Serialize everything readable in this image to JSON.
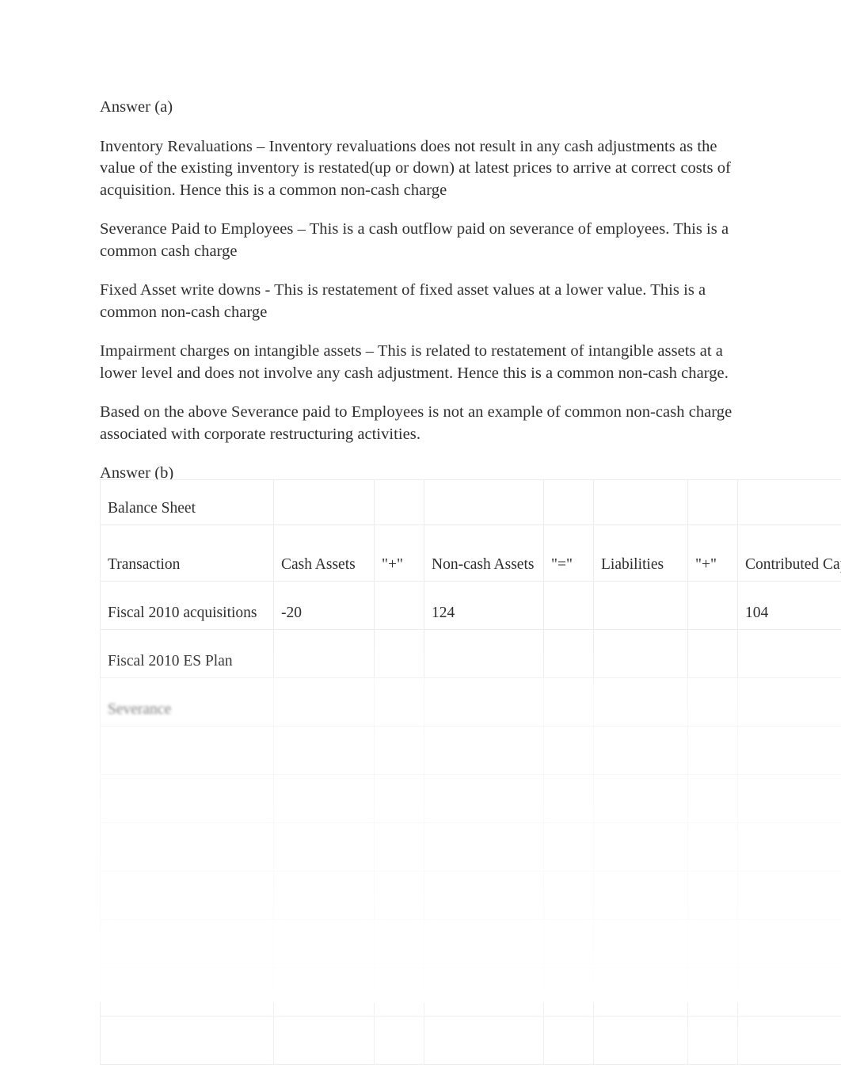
{
  "document": {
    "answer_a_heading": "Answer (a)",
    "answer_b_heading": "Answer (b)",
    "paragraphs": [
      "Inventory Revaluations – Inventory revaluations does not result in any cash adjustments as the value of the existing inventory is restated(up or down) at latest prices to arrive at correct costs of acquisition. Hence this is a common non-cash charge",
      "Severance Paid to Employees – This is a cash outflow paid on severance of employees. This is a common cash charge",
      "Fixed Asset write downs - This is restatement of fixed asset values at a lower value. This is a common non-cash charge",
      "Impairment charges on intangible assets – This is related to restatement of intangible assets at a lower level and does not involve any cash adjustment. Hence this is a common non-cash charge.",
      "Based on the above Severance paid to Employees is not an example of common non-cash charge associated with corporate restructuring activities."
    ]
  },
  "table": {
    "title": "Balance Sheet",
    "headers": {
      "transaction": "Transaction",
      "cash_assets": "Cash Assets",
      "op_plus_1": "\"+\"",
      "noncash_assets": "Non-cash Assets",
      "op_equals": "\"=\"",
      "liabilities": "Liabilities",
      "op_plus_2": "\"+\"",
      "contributed_capital": "Contributed Capital",
      "op_plus_3": "\"+\""
    },
    "rows": [
      {
        "transaction": "Fiscal 2010 acquisitions",
        "cash_assets": "-20",
        "op_plus_1": "",
        "noncash_assets": "124",
        "op_equals": "",
        "liabilities": "",
        "op_plus_2": "",
        "contributed_capital": "104",
        "op_plus_3": "",
        "blur": "none"
      },
      {
        "transaction": "Fiscal 2010 ES Plan",
        "cash_assets": "",
        "op_plus_1": "",
        "noncash_assets": "",
        "op_equals": "",
        "liabilities": "",
        "op_plus_2": "",
        "contributed_capital": "",
        "op_plus_3": "",
        "blur": "none"
      },
      {
        "transaction": "Severance",
        "cash_assets": "",
        "op_plus_1": "",
        "noncash_assets": "",
        "op_equals": "",
        "liabilities": "",
        "op_plus_2": "",
        "contributed_capital": "",
        "op_plus_3": "",
        "blur": "1"
      },
      {
        "transaction": "",
        "cash_assets": "",
        "op_plus_1": "",
        "noncash_assets": "",
        "op_equals": "",
        "liabilities": "",
        "op_plus_2": "",
        "contributed_capital": "",
        "op_plus_3": "",
        "blur": "2"
      },
      {
        "transaction": "",
        "cash_assets": "",
        "op_plus_1": "",
        "noncash_assets": "",
        "op_equals": "",
        "liabilities": "",
        "op_plus_2": "",
        "contributed_capital": "",
        "op_plus_3": "",
        "blur": "3"
      },
      {
        "transaction": "",
        "cash_assets": "",
        "op_plus_1": "",
        "noncash_assets": "",
        "op_equals": "",
        "liabilities": "",
        "op_plus_2": "",
        "contributed_capital": "",
        "op_plus_3": "",
        "blur": "3"
      },
      {
        "transaction": "",
        "cash_assets": "",
        "op_plus_1": "",
        "noncash_assets": "",
        "op_equals": "",
        "liabilities": "",
        "op_plus_2": "",
        "contributed_capital": "",
        "op_plus_3": "",
        "blur": "4"
      },
      {
        "transaction": "",
        "cash_assets": "",
        "op_plus_1": "",
        "noncash_assets": "",
        "op_equals": "",
        "liabilities": "",
        "op_plus_2": "",
        "contributed_capital": "",
        "op_plus_3": "",
        "blur": "4"
      },
      {
        "transaction": "",
        "cash_assets": "",
        "op_plus_1": "",
        "noncash_assets": "",
        "op_equals": "",
        "liabilities": "",
        "op_plus_2": "",
        "contributed_capital": "",
        "op_plus_3": "",
        "blur": "5"
      },
      {
        "transaction": "",
        "cash_assets": "",
        "op_plus_1": "",
        "noncash_assets": "",
        "op_equals": "",
        "liabilities": "",
        "op_plus_2": "",
        "contributed_capital": "",
        "op_plus_3": "",
        "blur": "5"
      }
    ]
  },
  "colors": {
    "page_background": "#ffffff",
    "text": "#2f2f2f",
    "table_gridline": "#ececec"
  }
}
